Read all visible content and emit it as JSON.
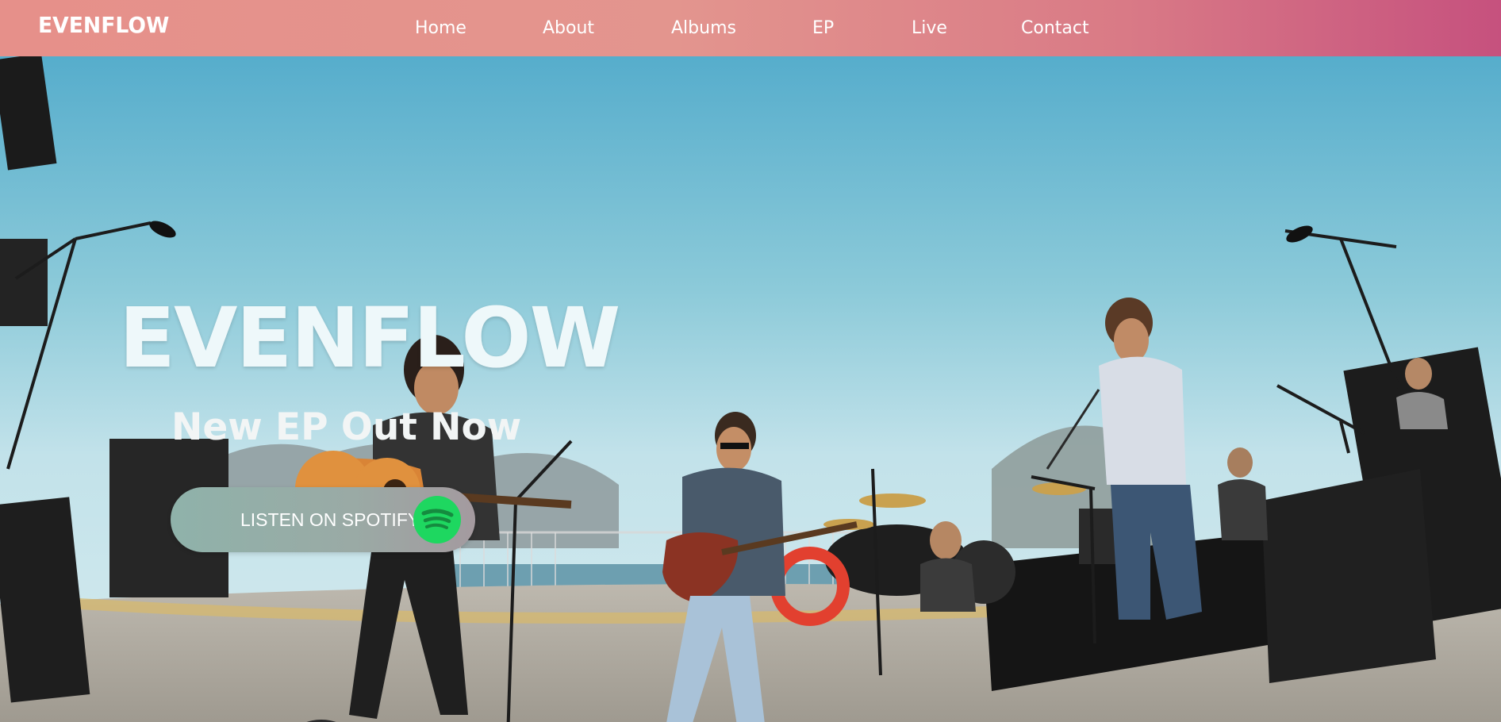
{
  "brand": {
    "logo_text": "EVENFLOW"
  },
  "nav": {
    "items": [
      {
        "label": "Home"
      },
      {
        "label": "About"
      },
      {
        "label": "Albums"
      },
      {
        "label": "EP"
      },
      {
        "label": "Live"
      },
      {
        "label": "Contact"
      }
    ]
  },
  "hero": {
    "title": "EVENFLOW",
    "subtitle": "New EP Out Now",
    "cta_label": "LISTEN ON SPOTIFY",
    "cta_icon": "spotify-icon",
    "background_image": "live band performing on outdoor stage by a lake"
  },
  "colors": {
    "nav_gradient_start": "#e6908a",
    "nav_gradient_end": "#c6517e",
    "spotify_green": "#1ed760",
    "text_white": "#ffffff"
  }
}
